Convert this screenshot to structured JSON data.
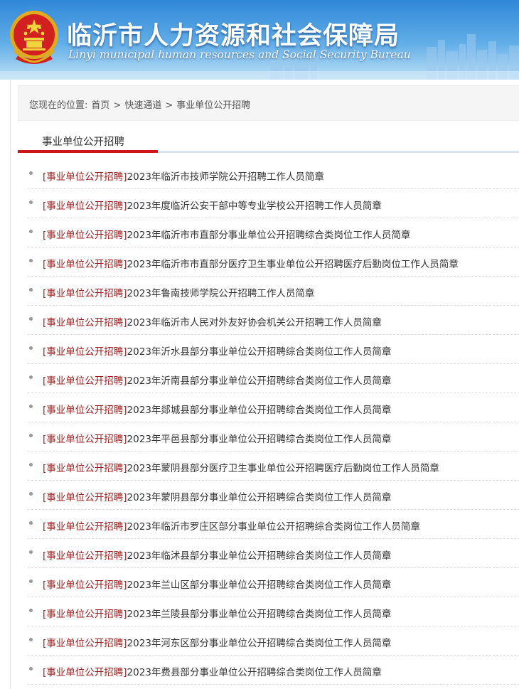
{
  "header": {
    "title": "临沂市人力资源和社会保障局",
    "subtitle": "Linyi municipal human resources and Social Security Bureau",
    "emblem_icon": "national-emblem-icon"
  },
  "breadcrumb": {
    "prefix": "您现在的位置:",
    "items": [
      "首页",
      "快速通道",
      "事业单位公开招聘"
    ],
    "separator": ">"
  },
  "section": {
    "tab_label": "事业单位公开招聘"
  },
  "news": [
    {
      "category": "[事业单位公开招聘]",
      "title": "2023年临沂市技师学院公开招聘工作人员简章"
    },
    {
      "category": "[事业单位公开招聘]",
      "title": "2023年度临沂公安干部中等专业学校公开招聘工作人员简章"
    },
    {
      "category": "[事业单位公开招聘]",
      "title": "2023年临沂市市直部分事业单位公开招聘综合类岗位工作人员简章"
    },
    {
      "category": "[事业单位公开招聘]",
      "title": "2023年临沂市市直部分医疗卫生事业单位公开招聘医疗后勤岗位工作人员简章"
    },
    {
      "category": "[事业单位公开招聘]",
      "title": "2023年鲁南技师学院公开招聘工作人员简章"
    },
    {
      "category": "[事业单位公开招聘]",
      "title": "2023年临沂市人民对外友好协会机关公开招聘工作人员简章"
    },
    {
      "category": "[事业单位公开招聘]",
      "title": "2023年沂水县部分事业单位公开招聘综合类岗位工作人员简章"
    },
    {
      "category": "[事业单位公开招聘]",
      "title": "2023年沂南县部分事业单位公开招聘综合类岗位工作人员简章"
    },
    {
      "category": "[事业单位公开招聘]",
      "title": "2023年郯城县部分事业单位公开招聘综合类岗位工作人员简章"
    },
    {
      "category": "[事业单位公开招聘]",
      "title": "2023年平邑县部分事业单位公开招聘综合类岗位工作人员简章"
    },
    {
      "category": "[事业单位公开招聘]",
      "title": "2023年蒙阴县部分医疗卫生事业单位公开招聘医疗后勤岗位工作人员简章"
    },
    {
      "category": "[事业单位公开招聘]",
      "title": "2023年蒙阴县部分事业单位公开招聘综合类岗位工作人员简章"
    },
    {
      "category": "[事业单位公开招聘]",
      "title": "2023年临沂市罗庄区部分事业单位公开招聘综合类岗位工作人员简章"
    },
    {
      "category": "[事业单位公开招聘]",
      "title": "2023年临沭县部分事业单位公开招聘综合类岗位工作人员简章"
    },
    {
      "category": "[事业单位公开招聘]",
      "title": "2023年兰山区部分事业单位公开招聘综合类岗位工作人员简章"
    },
    {
      "category": "[事业单位公开招聘]",
      "title": "2023年兰陵县部分事业单位公开招聘综合类岗位工作人员简章"
    },
    {
      "category": "[事业单位公开招聘]",
      "title": "2023年河东区部分事业单位公开招聘综合类岗位工作人员简章"
    },
    {
      "category": "[事业单位公开招聘]",
      "title": "2023年费县部分事业单位公开招聘综合类岗位工作人员简章"
    }
  ],
  "colors": {
    "accent_red": "#d1161b",
    "header_blue": "#2f88d8",
    "category_text": "#9b1c1c"
  }
}
